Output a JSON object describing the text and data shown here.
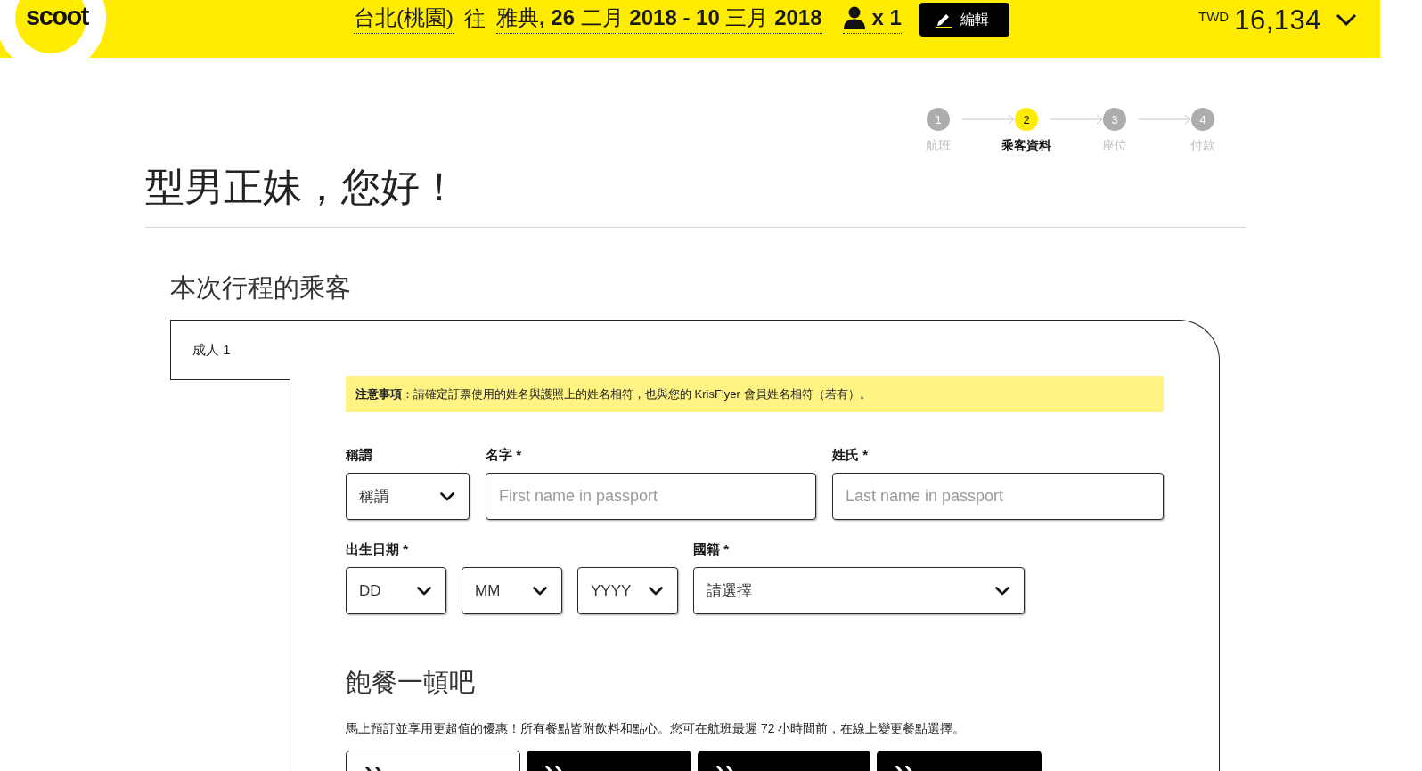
{
  "header": {
    "logo": "scoot",
    "origin": "台北(桃園)",
    "connector": "往",
    "trip": "雅典**, 26** 二月 **2018 - 10** 三月 **2018**",
    "passengers": "x 1",
    "edit_button": "編輯",
    "currency": "TWD",
    "total": "16,134"
  },
  "steps": [
    {
      "number": "1",
      "label": "航班",
      "selected": false
    },
    {
      "number": "2",
      "label": "乘客資料",
      "selected": true
    },
    {
      "number": "3",
      "label": "座位",
      "selected": false
    },
    {
      "number": "4",
      "label": "付款",
      "selected": false
    }
  ],
  "greeting": "型男正妹，您好！",
  "passengers_section": {
    "title": "本次行程的乘客",
    "tabs": [
      {
        "label": "成人 1",
        "selected": true
      }
    ],
    "notice": "**注意事項**：請確定訂票使用的姓名與護照上的姓名相符，也與您的 KrisFlyer 會員姓名相符（若有）。",
    "form_rows": [
      [
        {
          "label": "稱謂",
          "controls": [
            {
              "kind": "select",
              "value": "稱謂"
            }
          ]
        },
        {
          "label": "名字 *",
          "controls": [
            {
              "kind": "text",
              "placeholder": "First name in passport"
            }
          ]
        },
        {
          "label": "姓氏 *",
          "controls": [
            {
              "kind": "text",
              "placeholder": "Last name in passport"
            }
          ]
        }
      ],
      [
        {
          "label": "出生日期 *",
          "controls": [
            {
              "kind": "select",
              "value": "DD"
            },
            {
              "kind": "select",
              "value": "MM"
            },
            {
              "kind": "select",
              "value": "YYYY"
            }
          ]
        },
        {
          "label": "國籍 *",
          "controls": [
            {
              "kind": "select",
              "value": "請選擇"
            }
          ]
        }
      ]
    ]
  },
  "meals": {
    "title": "飽餐一頓吧",
    "description": "馬上預訂並享用更超值的優惠！所有餐點皆附飲料和點心。您可在航班最遲 72 小時間前，在線上變更餐點選擇。",
    "options": [
      {
        "kind": "outline"
      },
      {
        "kind": "filled"
      },
      {
        "kind": "filled"
      },
      {
        "kind": "filled"
      }
    ]
  }
}
